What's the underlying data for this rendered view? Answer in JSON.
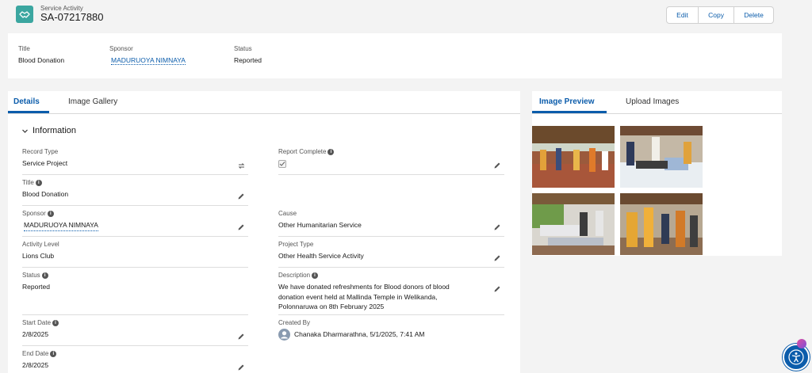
{
  "header": {
    "object_label": "Service Activity",
    "record_number": "SA-07217880",
    "icon": "handshake-icon",
    "accent": "#3ba6a0"
  },
  "actions": {
    "edit": "Edit",
    "copy": "Copy",
    "delete": "Delete"
  },
  "highlights": {
    "title_label": "Title",
    "title_value": "Blood Donation",
    "sponsor_label": "Sponsor",
    "sponsor_value": "MADURUOYA NIMNAYA",
    "status_label": "Status",
    "status_value": "Reported"
  },
  "detail_tabs": {
    "details": "Details",
    "gallery": "Image Gallery"
  },
  "section": {
    "title": "Information"
  },
  "fields": {
    "record_type": {
      "label": "Record Type",
      "value": "Service Project"
    },
    "report_complete": {
      "label": "Report Complete",
      "checked": true
    },
    "title": {
      "label": "Title",
      "value": "Blood Donation"
    },
    "sponsor": {
      "label": "Sponsor",
      "value": "MADURUOYA NIMNAYA"
    },
    "cause": {
      "label": "Cause",
      "value": "Other Humanitarian Service"
    },
    "activity_level": {
      "label": "Activity Level",
      "value": "Lions Club"
    },
    "project_type": {
      "label": "Project Type",
      "value": "Other Health Service Activity"
    },
    "status": {
      "label": "Status",
      "value": "Reported"
    },
    "description": {
      "label": "Description",
      "line1": "We have donated refreshments for Blood donors of blood",
      "line2": "donation event held at Mallinda Temple in Welikanda,",
      "line3": "Polonnaruwa on 8th February 2025"
    },
    "start_date": {
      "label": "Start Date",
      "value": "2/8/2025"
    },
    "created_by": {
      "label": "Created By",
      "user": "Chanaka Dharmarathna",
      "timestamp": ", 5/1/2025, 7:41 AM"
    },
    "end_date": {
      "label": "End Date",
      "value": "2/8/2025"
    }
  },
  "preview_tabs": {
    "preview": "Image Preview",
    "upload": "Upload Images"
  },
  "colors": {
    "link": "#0b5cab",
    "background": "#f3f3f3"
  }
}
